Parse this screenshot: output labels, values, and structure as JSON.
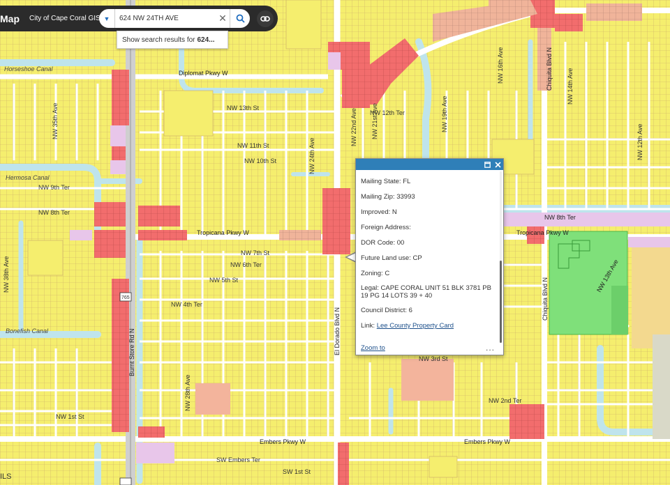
{
  "app": {
    "title": "Map",
    "subtitle": "City of Cape Coral GIS"
  },
  "search": {
    "value": "624 NW 24TH AVE",
    "suggestion_prefix": "Show search results for",
    "suggestion_bold": "624..."
  },
  "popup": {
    "rows": [
      {
        "label": "Mailing State:",
        "value": "FL"
      },
      {
        "label": "Mailing Zip:",
        "value": "33993"
      },
      {
        "label": "Improved:",
        "value": "N"
      },
      {
        "label": "Foreign Address:",
        "value": ""
      },
      {
        "label": "DOR Code:",
        "value": "00"
      },
      {
        "label": "Future Land use:",
        "value": "CP"
      },
      {
        "label": "Zoning:",
        "value": "C"
      },
      {
        "label": "Legal:",
        "value": "CAPE CORAL UNIT 51 BLK 3781 PB 19 PG 14 LOTS 39 + 40"
      },
      {
        "label": "Council District:",
        "value": "6"
      }
    ],
    "link_label": "Link:",
    "link_text": "Lee County Property Card",
    "zoom_to": "Zoom to",
    "more": "..."
  },
  "map": {
    "canals": [
      "Horseshoe Canal",
      "Hermosa Canal",
      "Bonefish Canal"
    ],
    "major_roads": [
      "Diplomat Pkwy W",
      "Tropicana Pkwy W",
      "Embers Pkwy W",
      "Burnt Store Rd N",
      "El Dorado Blvd N",
      "Chiquita Blvd N",
      "NW 13th Ave",
      "NW 8th Ter"
    ],
    "streets": [
      "NW 13th St",
      "NW 12th Ter",
      "NW 11th St",
      "NW 10th St",
      "NW 9th Ter",
      "NW 8th Ter",
      "NW 7th St",
      "NW 6th Ter",
      "NW 5th St",
      "NW 4th Ter",
      "NW 3rd St",
      "NW 2nd Ter",
      "NW 1st St",
      "SW 1st St",
      "SW Embers Ter",
      "NW 24th Ave",
      "NW 22nd Ave",
      "NW 28th Ave",
      "NW 21st Ave",
      "NW 19th Ave",
      "NW 16th Ave",
      "NW 14th Ave",
      "NW 12th Ave",
      "NW 35th Ave",
      "NW 38th Ave"
    ],
    "route_marker": "765",
    "colors": {
      "residential": "#f5ee6e",
      "commercial": "#f26d6d",
      "institutional": "#f0b49a",
      "park": "#7fe07a",
      "water": "#bfe4ec",
      "road": "#ffffff",
      "parcel_line": "#c9a96a"
    }
  },
  "attribution": "ILS"
}
